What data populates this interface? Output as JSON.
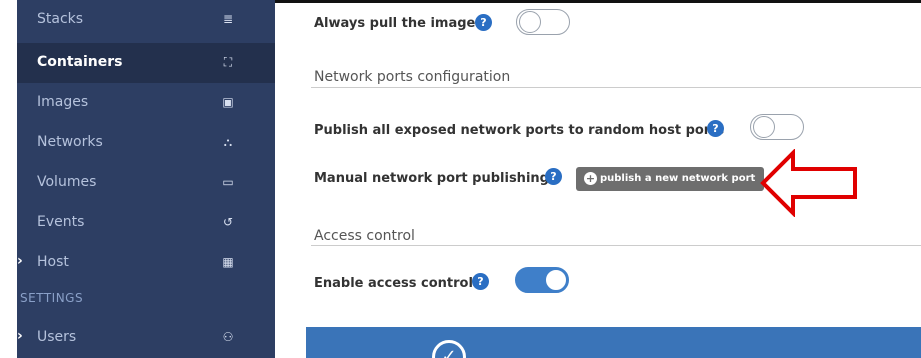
{
  "sidebar": {
    "items": [
      {
        "label": "Stacks",
        "icon": "stacks-icon",
        "glyph": "≣"
      },
      {
        "label": "Containers",
        "icon": "containers-icon",
        "glyph": "⛶",
        "active": true
      },
      {
        "label": "Images",
        "icon": "images-icon",
        "glyph": "▣"
      },
      {
        "label": "Networks",
        "icon": "networks-icon",
        "glyph": "⛬"
      },
      {
        "label": "Volumes",
        "icon": "volumes-icon",
        "glyph": "▭"
      },
      {
        "label": "Events",
        "icon": "events-icon",
        "glyph": "↺"
      },
      {
        "label": "Host",
        "icon": "host-icon",
        "glyph": "▦",
        "caret": "›"
      }
    ],
    "settings_heading": "SETTINGS",
    "users": {
      "label": "Users",
      "icon": "users-icon",
      "glyph": "⚇",
      "caret": "›"
    }
  },
  "form": {
    "always_pull": {
      "label": "Always pull the image",
      "help": "?",
      "enabled": false
    },
    "network_ports": {
      "section_title": "Network ports configuration",
      "publish_all": {
        "label": "Publish all exposed network ports to random host ports",
        "help": "?",
        "enabled": false
      },
      "manual": {
        "label": "Manual network port publishing",
        "help": "?",
        "button_label": "publish a new network port",
        "button_icon": "+"
      }
    },
    "access_control": {
      "section_title": "Access control",
      "enable": {
        "label": "Enable access control",
        "help": "?",
        "enabled": true
      }
    },
    "deploy": {
      "icon": "✓"
    }
  },
  "colors": {
    "sidebar_bg": "#2d3e63",
    "sidebar_active": "#23304d",
    "accent_blue": "#3a74b8",
    "help_blue": "#2a6ec3",
    "button_gray": "#6e6e6e",
    "annotation_red": "#e00000"
  }
}
